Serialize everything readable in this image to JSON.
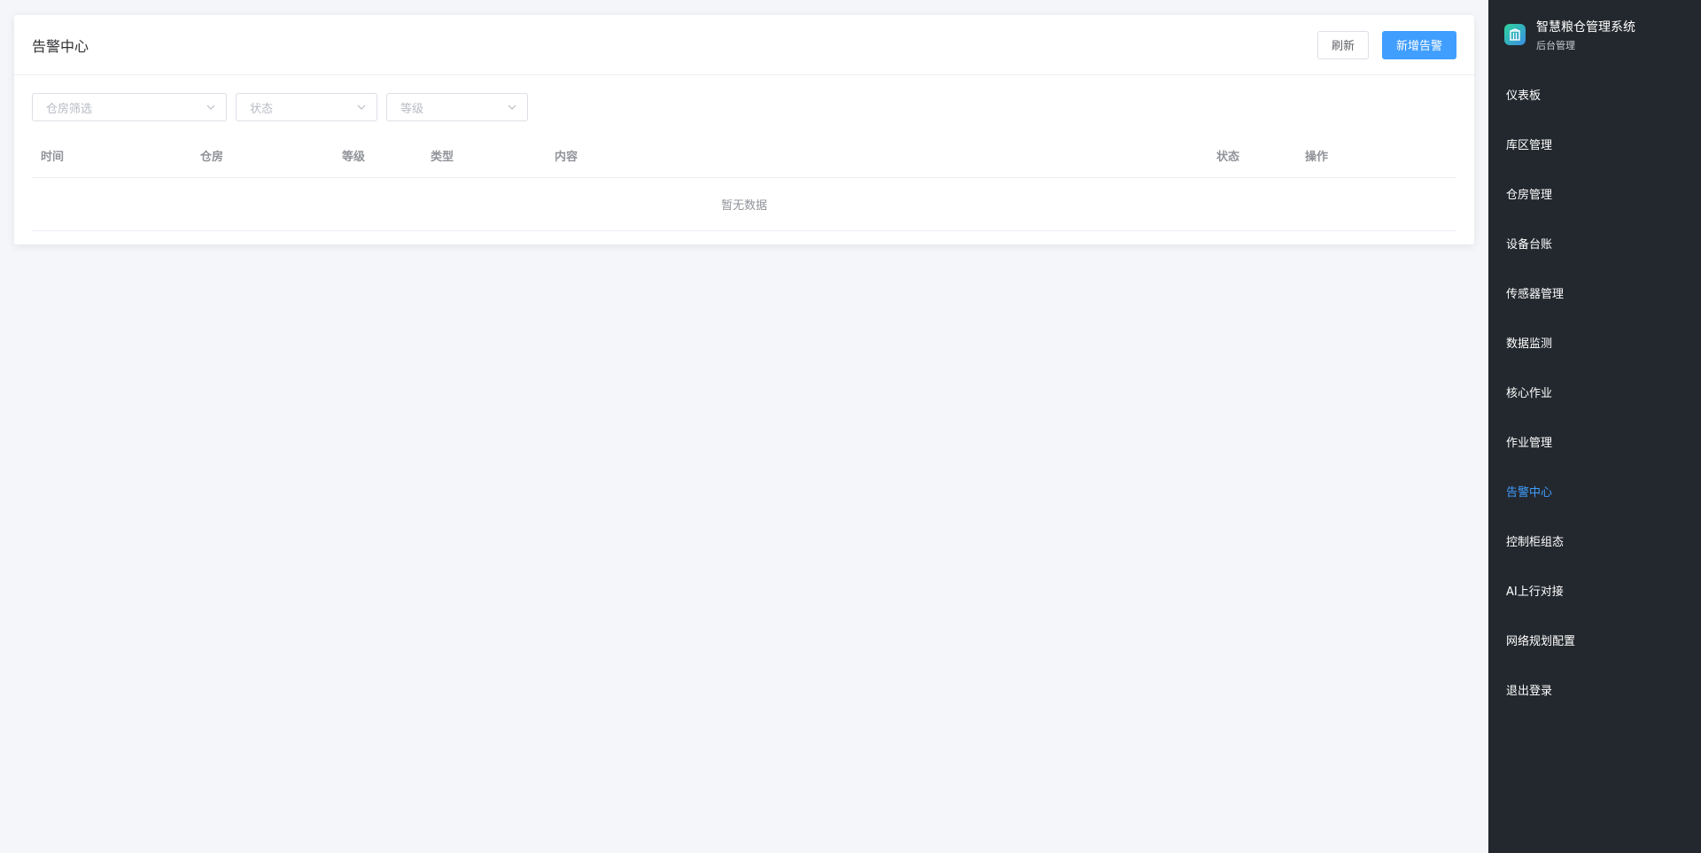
{
  "header": {
    "title": "告警中心",
    "refresh_label": "刷新",
    "add_label": "新增告警"
  },
  "filters": {
    "warehouse_placeholder": "仓房筛选",
    "status_placeholder": "状态",
    "level_placeholder": "等级"
  },
  "table": {
    "columns": [
      "时间",
      "仓房",
      "等级",
      "类型",
      "内容",
      "状态",
      "操作"
    ],
    "rows": [],
    "empty_text": "暂无数据"
  },
  "sidebar": {
    "brand_title": "智慧粮仓管理系统",
    "brand_subtitle": "后台管理",
    "logo_icon": "warehouse-logo-icon",
    "active_color": "#409eff",
    "items": [
      {
        "label": "仪表板"
      },
      {
        "label": "库区管理"
      },
      {
        "label": "仓房管理"
      },
      {
        "label": "设备台账"
      },
      {
        "label": "传感器管理"
      },
      {
        "label": "数据监测"
      },
      {
        "label": "核心作业"
      },
      {
        "label": "作业管理"
      },
      {
        "label": "告警中心",
        "active": true
      },
      {
        "label": "控制柜组态"
      },
      {
        "label": "AI上行对接"
      },
      {
        "label": "网络规划配置"
      },
      {
        "label": "退出登录"
      }
    ]
  },
  "colors": {
    "primary": "#409eff",
    "sidebar_bg": "#23282e",
    "page_bg": "#f4f6f9"
  }
}
